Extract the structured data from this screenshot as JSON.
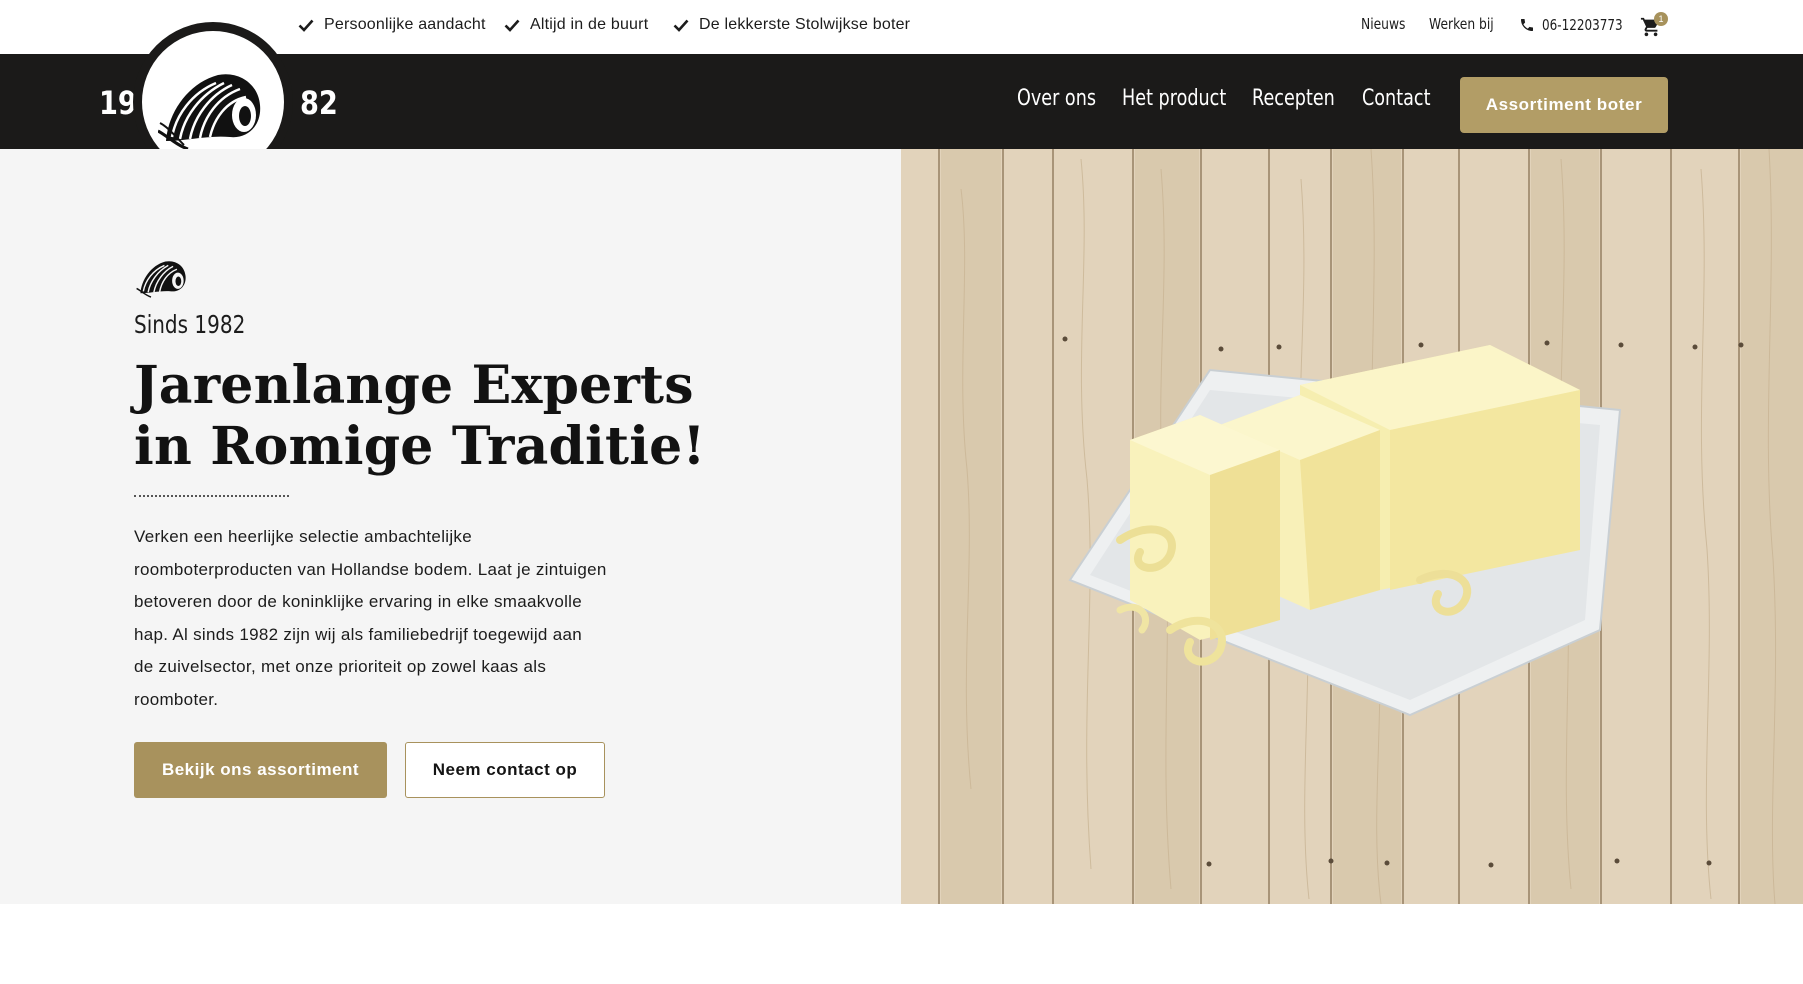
{
  "topbar": {
    "usps": [
      "Persoonlijke aandacht",
      "Altijd in de buurt",
      "De lekkerste Stolwijkse boter"
    ],
    "links": {
      "news": "Nieuws",
      "work": "Werken bij"
    },
    "phone": "06-12203773",
    "cart_count": "1",
    "icons": {
      "usp": "check-icon",
      "phone": "phone-icon",
      "cart": "cart-icon"
    }
  },
  "nav": {
    "year_left": "19",
    "year_right": "82",
    "items": [
      "Over ons",
      "Het product",
      "Recepten",
      "Contact"
    ],
    "cta": "Assortiment boter"
  },
  "hero": {
    "since": "Sinds 1982",
    "headline": [
      "Jarenlange Experts",
      "in Romige Traditie!"
    ],
    "description": [
      "Verken een heerlijke selectie ambachtelijke",
      "roomboterproducten van Hollandse bodem. Laat je zintuigen",
      "betoveren door de koninklijke ervaring in elke smaakvolle",
      "hap. Al sinds 1982 zijn wij als familiebedrijf toegewijd aan",
      "de zuivelsector, met onze prioriteit op zowel kaas als",
      "roomboter."
    ],
    "primary_button": "Bekijk ons assortiment",
    "secondary_button": "Neem contact op"
  },
  "colors": {
    "accent": "#a8925d",
    "nav_bg": "#1b1a19",
    "hero_bg": "#f5f5f5"
  }
}
